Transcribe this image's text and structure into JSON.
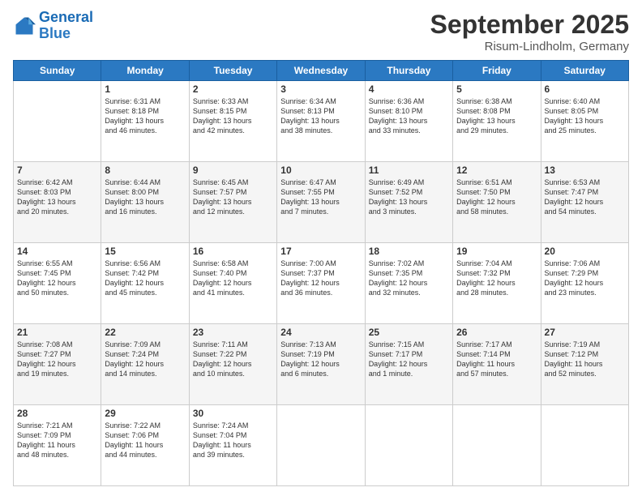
{
  "logo": {
    "line1": "General",
    "line2": "Blue"
  },
  "title": "September 2025",
  "location": "Risum-Lindholm, Germany",
  "days_header": [
    "Sunday",
    "Monday",
    "Tuesday",
    "Wednesday",
    "Thursday",
    "Friday",
    "Saturday"
  ],
  "weeks": [
    [
      {
        "day": "",
        "info": ""
      },
      {
        "day": "1",
        "info": "Sunrise: 6:31 AM\nSunset: 8:18 PM\nDaylight: 13 hours\nand 46 minutes."
      },
      {
        "day": "2",
        "info": "Sunrise: 6:33 AM\nSunset: 8:15 PM\nDaylight: 13 hours\nand 42 minutes."
      },
      {
        "day": "3",
        "info": "Sunrise: 6:34 AM\nSunset: 8:13 PM\nDaylight: 13 hours\nand 38 minutes."
      },
      {
        "day": "4",
        "info": "Sunrise: 6:36 AM\nSunset: 8:10 PM\nDaylight: 13 hours\nand 33 minutes."
      },
      {
        "day": "5",
        "info": "Sunrise: 6:38 AM\nSunset: 8:08 PM\nDaylight: 13 hours\nand 29 minutes."
      },
      {
        "day": "6",
        "info": "Sunrise: 6:40 AM\nSunset: 8:05 PM\nDaylight: 13 hours\nand 25 minutes."
      }
    ],
    [
      {
        "day": "7",
        "info": "Sunrise: 6:42 AM\nSunset: 8:03 PM\nDaylight: 13 hours\nand 20 minutes."
      },
      {
        "day": "8",
        "info": "Sunrise: 6:44 AM\nSunset: 8:00 PM\nDaylight: 13 hours\nand 16 minutes."
      },
      {
        "day": "9",
        "info": "Sunrise: 6:45 AM\nSunset: 7:57 PM\nDaylight: 13 hours\nand 12 minutes."
      },
      {
        "day": "10",
        "info": "Sunrise: 6:47 AM\nSunset: 7:55 PM\nDaylight: 13 hours\nand 7 minutes."
      },
      {
        "day": "11",
        "info": "Sunrise: 6:49 AM\nSunset: 7:52 PM\nDaylight: 13 hours\nand 3 minutes."
      },
      {
        "day": "12",
        "info": "Sunrise: 6:51 AM\nSunset: 7:50 PM\nDaylight: 12 hours\nand 58 minutes."
      },
      {
        "day": "13",
        "info": "Sunrise: 6:53 AM\nSunset: 7:47 PM\nDaylight: 12 hours\nand 54 minutes."
      }
    ],
    [
      {
        "day": "14",
        "info": "Sunrise: 6:55 AM\nSunset: 7:45 PM\nDaylight: 12 hours\nand 50 minutes."
      },
      {
        "day": "15",
        "info": "Sunrise: 6:56 AM\nSunset: 7:42 PM\nDaylight: 12 hours\nand 45 minutes."
      },
      {
        "day": "16",
        "info": "Sunrise: 6:58 AM\nSunset: 7:40 PM\nDaylight: 12 hours\nand 41 minutes."
      },
      {
        "day": "17",
        "info": "Sunrise: 7:00 AM\nSunset: 7:37 PM\nDaylight: 12 hours\nand 36 minutes."
      },
      {
        "day": "18",
        "info": "Sunrise: 7:02 AM\nSunset: 7:35 PM\nDaylight: 12 hours\nand 32 minutes."
      },
      {
        "day": "19",
        "info": "Sunrise: 7:04 AM\nSunset: 7:32 PM\nDaylight: 12 hours\nand 28 minutes."
      },
      {
        "day": "20",
        "info": "Sunrise: 7:06 AM\nSunset: 7:29 PM\nDaylight: 12 hours\nand 23 minutes."
      }
    ],
    [
      {
        "day": "21",
        "info": "Sunrise: 7:08 AM\nSunset: 7:27 PM\nDaylight: 12 hours\nand 19 minutes."
      },
      {
        "day": "22",
        "info": "Sunrise: 7:09 AM\nSunset: 7:24 PM\nDaylight: 12 hours\nand 14 minutes."
      },
      {
        "day": "23",
        "info": "Sunrise: 7:11 AM\nSunset: 7:22 PM\nDaylight: 12 hours\nand 10 minutes."
      },
      {
        "day": "24",
        "info": "Sunrise: 7:13 AM\nSunset: 7:19 PM\nDaylight: 12 hours\nand 6 minutes."
      },
      {
        "day": "25",
        "info": "Sunrise: 7:15 AM\nSunset: 7:17 PM\nDaylight: 12 hours\nand 1 minute."
      },
      {
        "day": "26",
        "info": "Sunrise: 7:17 AM\nSunset: 7:14 PM\nDaylight: 11 hours\nand 57 minutes."
      },
      {
        "day": "27",
        "info": "Sunrise: 7:19 AM\nSunset: 7:12 PM\nDaylight: 11 hours\nand 52 minutes."
      }
    ],
    [
      {
        "day": "28",
        "info": "Sunrise: 7:21 AM\nSunset: 7:09 PM\nDaylight: 11 hours\nand 48 minutes."
      },
      {
        "day": "29",
        "info": "Sunrise: 7:22 AM\nSunset: 7:06 PM\nDaylight: 11 hours\nand 44 minutes."
      },
      {
        "day": "30",
        "info": "Sunrise: 7:24 AM\nSunset: 7:04 PM\nDaylight: 11 hours\nand 39 minutes."
      },
      {
        "day": "",
        "info": ""
      },
      {
        "day": "",
        "info": ""
      },
      {
        "day": "",
        "info": ""
      },
      {
        "day": "",
        "info": ""
      }
    ]
  ]
}
